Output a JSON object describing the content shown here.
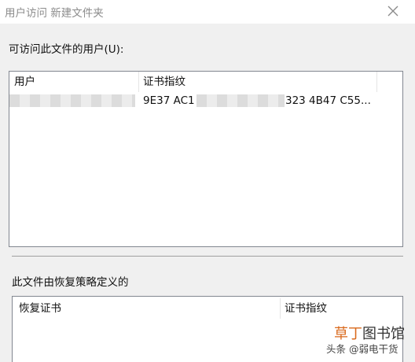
{
  "window": {
    "title": "用户访问 新建文件夹",
    "close_icon": "close-icon"
  },
  "users_section": {
    "label": "可访问此文件的用户(U):",
    "columns": [
      "用户",
      "证书指纹"
    ],
    "rows": [
      {
        "user": "",
        "thumbprint_start": "9E37 AC1",
        "thumbprint_end": "323 4B47 C55..."
      }
    ]
  },
  "recovery_section": {
    "label": "此文件由恢复策略定义的",
    "columns": [
      "恢复证书",
      "证书指纹"
    ]
  },
  "watermark": {
    "brand_accent": "草丁",
    "brand_rest": "图书馆",
    "source": "头条 @弱电干货"
  },
  "colors": {
    "window_bg": "#f0f0f0",
    "list_border": "#828790",
    "watermark_accent": "#d9691c"
  }
}
